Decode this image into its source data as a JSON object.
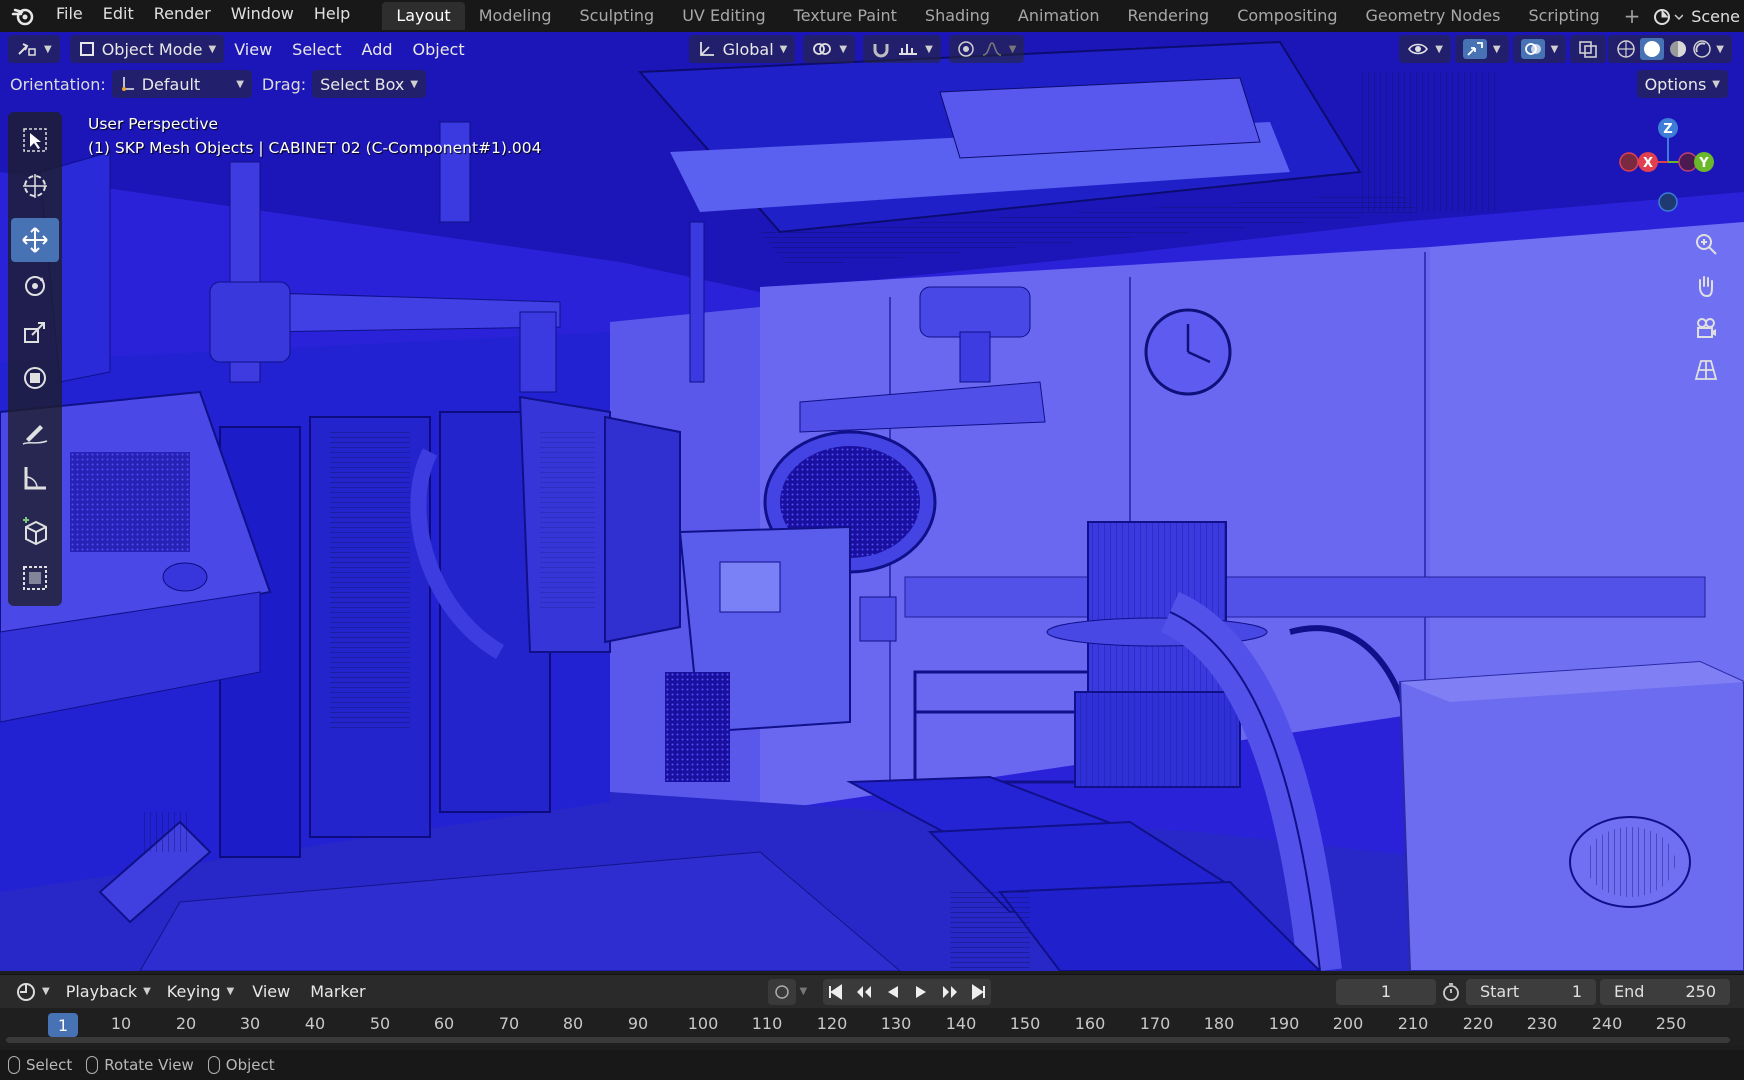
{
  "menu": {
    "items": [
      "File",
      "Edit",
      "Render",
      "Window",
      "Help"
    ]
  },
  "workspaces": {
    "tabs": [
      "Layout",
      "Modeling",
      "Sculpting",
      "UV Editing",
      "Texture Paint",
      "Shading",
      "Animation",
      "Rendering",
      "Compositing",
      "Geometry Nodes",
      "Scripting"
    ],
    "active": "Layout"
  },
  "scene": {
    "label": "Scene"
  },
  "viewport_header": {
    "mode": "Object Mode",
    "view": "View",
    "select": "Select",
    "add": "Add",
    "object": "Object",
    "transform_orientation": "Global"
  },
  "tool_settings": {
    "orientation_label": "Orientation:",
    "orientation_value": "Default",
    "drag_label": "Drag:",
    "drag_value": "Select Box",
    "options": "Options"
  },
  "overlay": {
    "perspective": "User Perspective",
    "object_info": "(1) SKP Mesh Objects | CABINET 02 (C-Component#1).004"
  },
  "gizmo": {
    "x": "X",
    "y": "Y",
    "z": "Z"
  },
  "timeline": {
    "playback": "Playback",
    "keying": "Keying",
    "view": "View",
    "marker": "Marker",
    "current_frame": "1",
    "start_label": "Start",
    "start_value": "1",
    "end_label": "End",
    "end_value": "250",
    "ruler_current": "1",
    "ruler_ticks": [
      "10",
      "20",
      "30",
      "40",
      "50",
      "60",
      "70",
      "80",
      "90",
      "100",
      "110",
      "120",
      "130",
      "140",
      "150",
      "160",
      "170",
      "180",
      "190",
      "200",
      "210",
      "220",
      "230",
      "240",
      "250"
    ]
  },
  "status_bar": {
    "select": "Select",
    "rotate_view": "Rotate View",
    "object": "Object"
  },
  "colors": {
    "viewport_blue": "#2a22d8",
    "wall_light": "#6e6cf0",
    "accent": "#4772b3"
  }
}
